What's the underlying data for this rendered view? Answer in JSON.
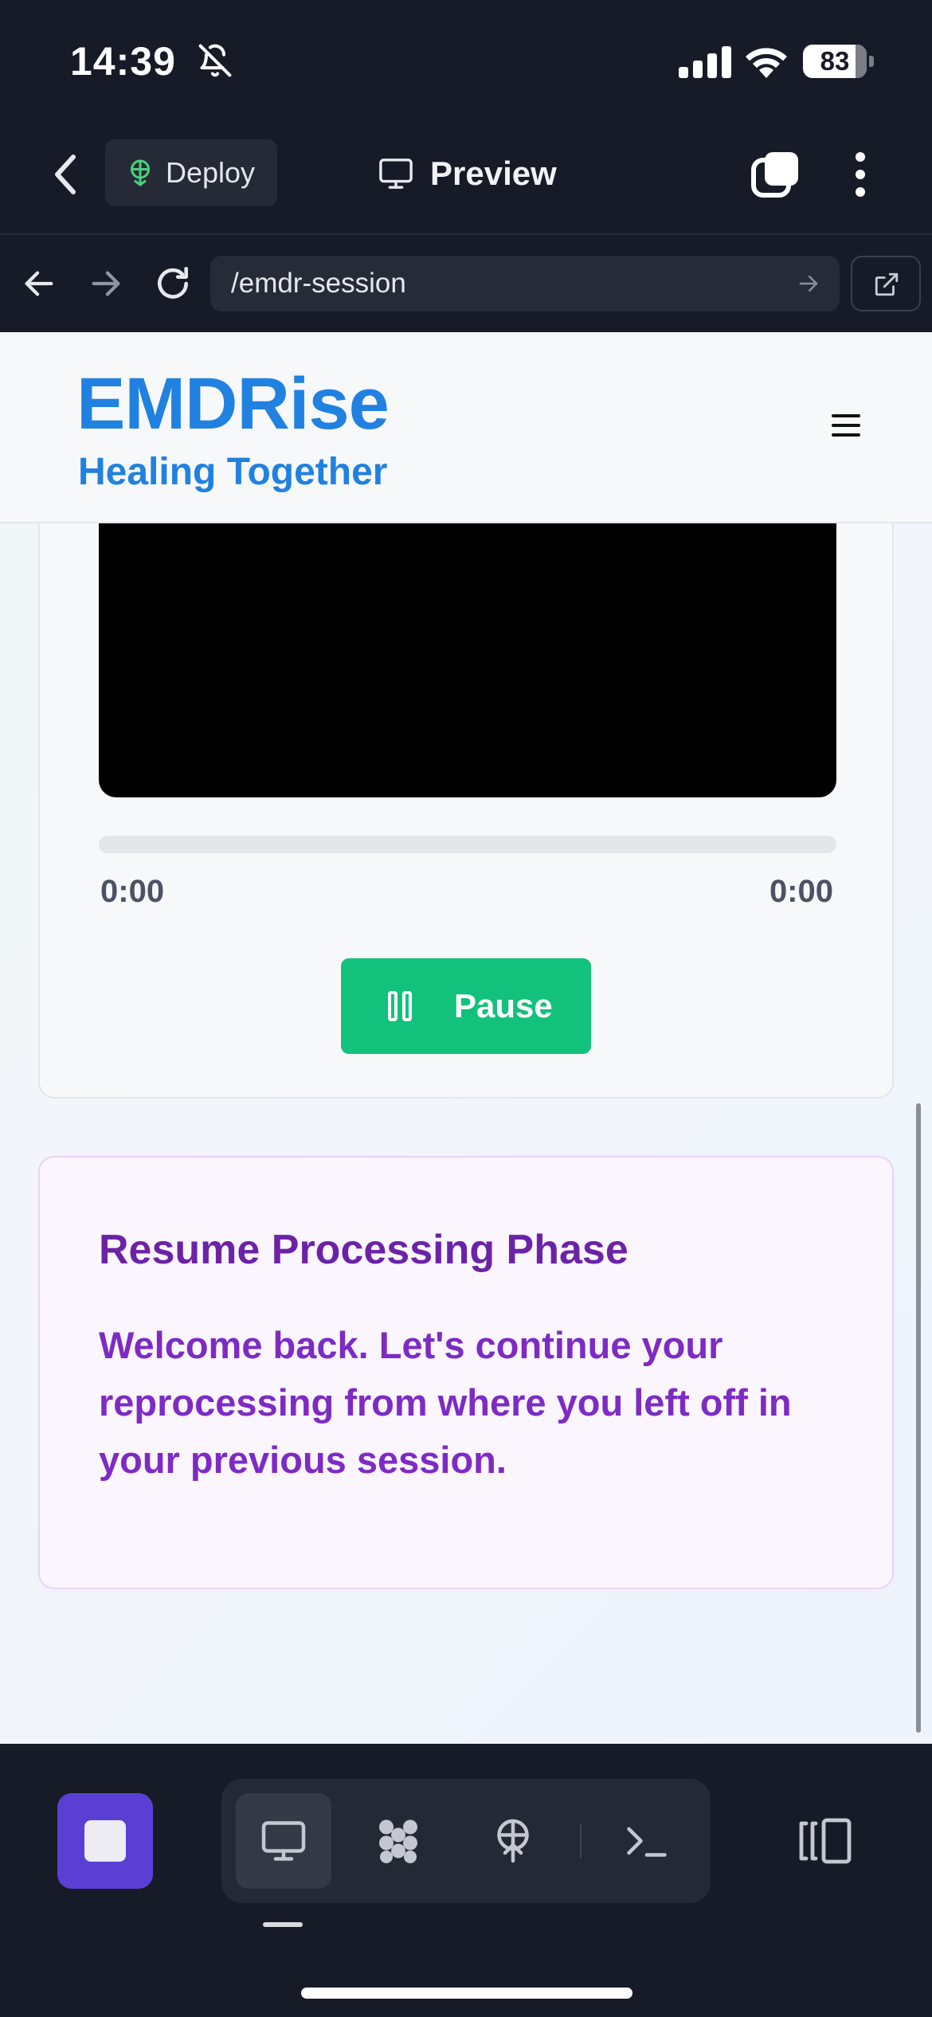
{
  "status_bar": {
    "time": "14:39",
    "battery": "83",
    "icons": [
      "bell-slash-icon",
      "cellular-signal-icon",
      "wifi-icon",
      "battery-icon"
    ]
  },
  "app_bar": {
    "deploy_label": "Deploy",
    "preview_label": "Preview",
    "icons": [
      "back-chevron-icon",
      "deploy-icon",
      "monitor-icon",
      "tabs-icon",
      "more-vertical-icon"
    ]
  },
  "browser": {
    "url": "/emdr-session",
    "icons": [
      "arrow-left-icon",
      "arrow-right-icon",
      "reload-icon",
      "go-arrow-icon",
      "external-link-icon"
    ]
  },
  "site": {
    "brand": "EMDRise",
    "tagline": "Healing Together",
    "menu_icon": "hamburger-menu-icon"
  },
  "player": {
    "current_time": "0:00",
    "duration": "0:00",
    "progress": 0,
    "pause_label": "Pause",
    "pause_icon": "pause-icon"
  },
  "resume_card": {
    "title": "Resume Processing Phase",
    "body": "Welcome back. Let's continue your reprocessing from where you left off in your previous session."
  },
  "bottom_bar": {
    "tools": [
      "stop-icon",
      "desktop-icon",
      "components-icon",
      "deploy-icon",
      "terminal-icon",
      "panel-toggle-icon"
    ],
    "active_tool": "desktop"
  },
  "colors": {
    "brand_blue": "#2181e0",
    "pause_green": "#12c17b",
    "resume_purple": "#6b23a6",
    "stop_purple": "#5b3fd4",
    "chrome_dark": "#171b27"
  }
}
